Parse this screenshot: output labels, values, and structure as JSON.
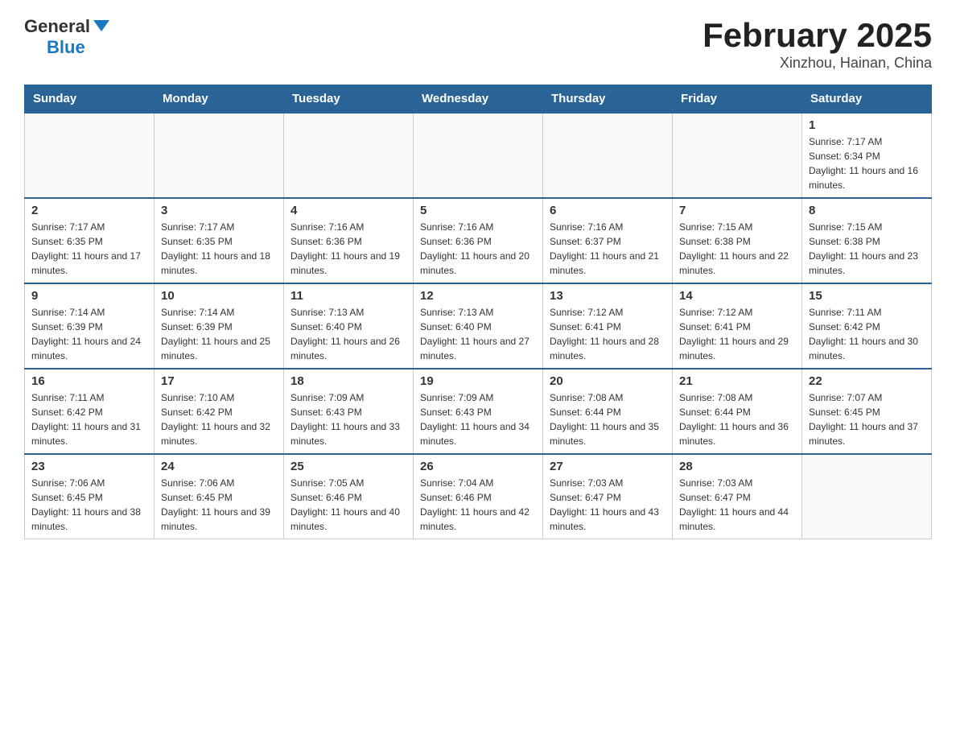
{
  "logo": {
    "general": "General",
    "triangle": "",
    "blue": "Blue"
  },
  "title": {
    "month_year": "February 2025",
    "location": "Xinzhou, Hainan, China"
  },
  "weekdays": [
    "Sunday",
    "Monday",
    "Tuesday",
    "Wednesday",
    "Thursday",
    "Friday",
    "Saturday"
  ],
  "weeks": [
    [
      {
        "day": "",
        "sunrise": "",
        "sunset": "",
        "daylight": ""
      },
      {
        "day": "",
        "sunrise": "",
        "sunset": "",
        "daylight": ""
      },
      {
        "day": "",
        "sunrise": "",
        "sunset": "",
        "daylight": ""
      },
      {
        "day": "",
        "sunrise": "",
        "sunset": "",
        "daylight": ""
      },
      {
        "day": "",
        "sunrise": "",
        "sunset": "",
        "daylight": ""
      },
      {
        "day": "",
        "sunrise": "",
        "sunset": "",
        "daylight": ""
      },
      {
        "day": "1",
        "sunrise": "Sunrise: 7:17 AM",
        "sunset": "Sunset: 6:34 PM",
        "daylight": "Daylight: 11 hours and 16 minutes."
      }
    ],
    [
      {
        "day": "2",
        "sunrise": "Sunrise: 7:17 AM",
        "sunset": "Sunset: 6:35 PM",
        "daylight": "Daylight: 11 hours and 17 minutes."
      },
      {
        "day": "3",
        "sunrise": "Sunrise: 7:17 AM",
        "sunset": "Sunset: 6:35 PM",
        "daylight": "Daylight: 11 hours and 18 minutes."
      },
      {
        "day": "4",
        "sunrise": "Sunrise: 7:16 AM",
        "sunset": "Sunset: 6:36 PM",
        "daylight": "Daylight: 11 hours and 19 minutes."
      },
      {
        "day": "5",
        "sunrise": "Sunrise: 7:16 AM",
        "sunset": "Sunset: 6:36 PM",
        "daylight": "Daylight: 11 hours and 20 minutes."
      },
      {
        "day": "6",
        "sunrise": "Sunrise: 7:16 AM",
        "sunset": "Sunset: 6:37 PM",
        "daylight": "Daylight: 11 hours and 21 minutes."
      },
      {
        "day": "7",
        "sunrise": "Sunrise: 7:15 AM",
        "sunset": "Sunset: 6:38 PM",
        "daylight": "Daylight: 11 hours and 22 minutes."
      },
      {
        "day": "8",
        "sunrise": "Sunrise: 7:15 AM",
        "sunset": "Sunset: 6:38 PM",
        "daylight": "Daylight: 11 hours and 23 minutes."
      }
    ],
    [
      {
        "day": "9",
        "sunrise": "Sunrise: 7:14 AM",
        "sunset": "Sunset: 6:39 PM",
        "daylight": "Daylight: 11 hours and 24 minutes."
      },
      {
        "day": "10",
        "sunrise": "Sunrise: 7:14 AM",
        "sunset": "Sunset: 6:39 PM",
        "daylight": "Daylight: 11 hours and 25 minutes."
      },
      {
        "day": "11",
        "sunrise": "Sunrise: 7:13 AM",
        "sunset": "Sunset: 6:40 PM",
        "daylight": "Daylight: 11 hours and 26 minutes."
      },
      {
        "day": "12",
        "sunrise": "Sunrise: 7:13 AM",
        "sunset": "Sunset: 6:40 PM",
        "daylight": "Daylight: 11 hours and 27 minutes."
      },
      {
        "day": "13",
        "sunrise": "Sunrise: 7:12 AM",
        "sunset": "Sunset: 6:41 PM",
        "daylight": "Daylight: 11 hours and 28 minutes."
      },
      {
        "day": "14",
        "sunrise": "Sunrise: 7:12 AM",
        "sunset": "Sunset: 6:41 PM",
        "daylight": "Daylight: 11 hours and 29 minutes."
      },
      {
        "day": "15",
        "sunrise": "Sunrise: 7:11 AM",
        "sunset": "Sunset: 6:42 PM",
        "daylight": "Daylight: 11 hours and 30 minutes."
      }
    ],
    [
      {
        "day": "16",
        "sunrise": "Sunrise: 7:11 AM",
        "sunset": "Sunset: 6:42 PM",
        "daylight": "Daylight: 11 hours and 31 minutes."
      },
      {
        "day": "17",
        "sunrise": "Sunrise: 7:10 AM",
        "sunset": "Sunset: 6:42 PM",
        "daylight": "Daylight: 11 hours and 32 minutes."
      },
      {
        "day": "18",
        "sunrise": "Sunrise: 7:09 AM",
        "sunset": "Sunset: 6:43 PM",
        "daylight": "Daylight: 11 hours and 33 minutes."
      },
      {
        "day": "19",
        "sunrise": "Sunrise: 7:09 AM",
        "sunset": "Sunset: 6:43 PM",
        "daylight": "Daylight: 11 hours and 34 minutes."
      },
      {
        "day": "20",
        "sunrise": "Sunrise: 7:08 AM",
        "sunset": "Sunset: 6:44 PM",
        "daylight": "Daylight: 11 hours and 35 minutes."
      },
      {
        "day": "21",
        "sunrise": "Sunrise: 7:08 AM",
        "sunset": "Sunset: 6:44 PM",
        "daylight": "Daylight: 11 hours and 36 minutes."
      },
      {
        "day": "22",
        "sunrise": "Sunrise: 7:07 AM",
        "sunset": "Sunset: 6:45 PM",
        "daylight": "Daylight: 11 hours and 37 minutes."
      }
    ],
    [
      {
        "day": "23",
        "sunrise": "Sunrise: 7:06 AM",
        "sunset": "Sunset: 6:45 PM",
        "daylight": "Daylight: 11 hours and 38 minutes."
      },
      {
        "day": "24",
        "sunrise": "Sunrise: 7:06 AM",
        "sunset": "Sunset: 6:45 PM",
        "daylight": "Daylight: 11 hours and 39 minutes."
      },
      {
        "day": "25",
        "sunrise": "Sunrise: 7:05 AM",
        "sunset": "Sunset: 6:46 PM",
        "daylight": "Daylight: 11 hours and 40 minutes."
      },
      {
        "day": "26",
        "sunrise": "Sunrise: 7:04 AM",
        "sunset": "Sunset: 6:46 PM",
        "daylight": "Daylight: 11 hours and 42 minutes."
      },
      {
        "day": "27",
        "sunrise": "Sunrise: 7:03 AM",
        "sunset": "Sunset: 6:47 PM",
        "daylight": "Daylight: 11 hours and 43 minutes."
      },
      {
        "day": "28",
        "sunrise": "Sunrise: 7:03 AM",
        "sunset": "Sunset: 6:47 PM",
        "daylight": "Daylight: 11 hours and 44 minutes."
      },
      {
        "day": "",
        "sunrise": "",
        "sunset": "",
        "daylight": ""
      }
    ]
  ]
}
